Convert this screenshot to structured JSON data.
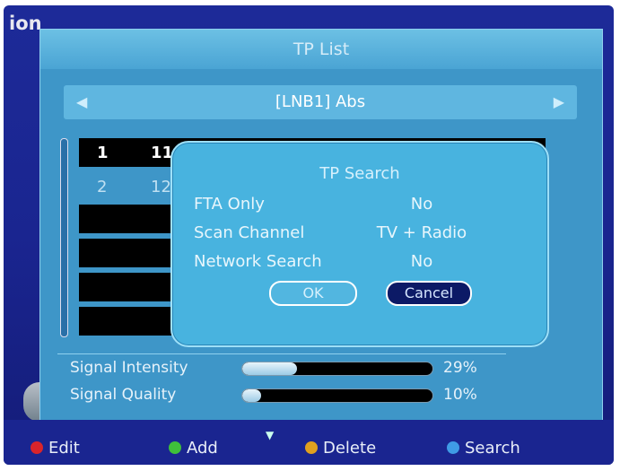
{
  "screen": {
    "corner_text": "ion"
  },
  "window": {
    "title": "TP List"
  },
  "header": {
    "label": "[LNB1] Abs",
    "prev_arrow": "◀",
    "next_arrow": "▶"
  },
  "tp_list": {
    "rows": [
      {
        "num": "1",
        "freq": "11"
      },
      {
        "num": "2",
        "freq": "12"
      }
    ]
  },
  "dialog": {
    "title": "TP Search",
    "fields": [
      {
        "label": "FTA Only",
        "value": "No"
      },
      {
        "label": "Scan Channel",
        "value": "TV + Radio"
      },
      {
        "label": "Network Search",
        "value": "No"
      }
    ],
    "ok_label": "OK",
    "cancel_label": "Cancel"
  },
  "signal": {
    "intensity_label": "Signal Intensity",
    "intensity_percent": "29%",
    "intensity_value": 0.29,
    "quality_label": "Signal Quality",
    "quality_percent": "10%",
    "quality_value": 0.1
  },
  "footer": {
    "edit_label": "Edit",
    "add_label": "Add",
    "delete_label": "Delete",
    "search_label": "Search",
    "colors": {
      "edit": "#d9242a",
      "add": "#3fbf3a",
      "delete": "#e0a020",
      "search": "#3f9be6"
    }
  }
}
